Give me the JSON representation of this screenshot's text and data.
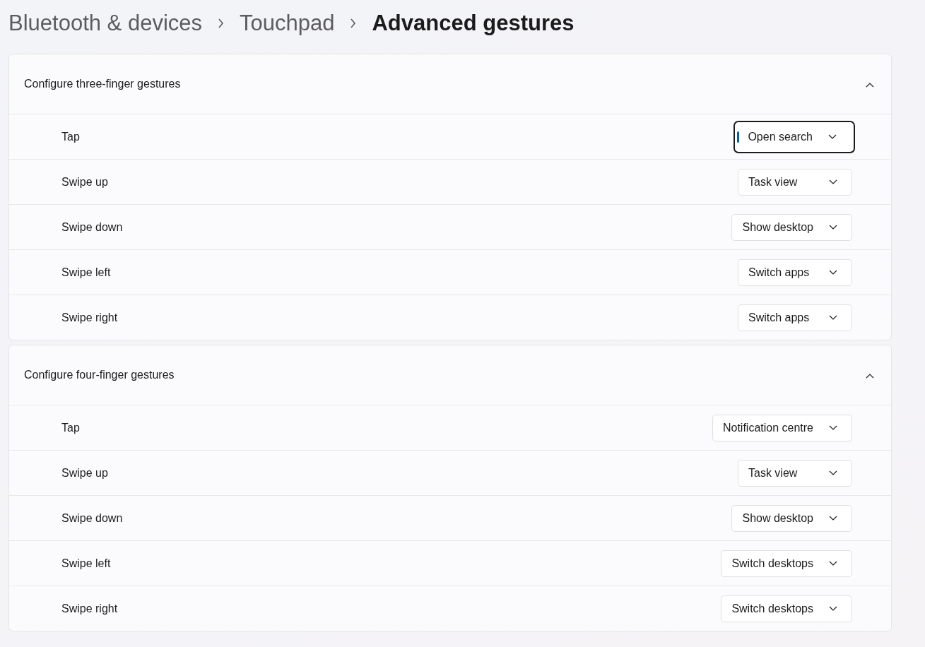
{
  "breadcrumb": [
    {
      "label": "Bluetooth & devices",
      "current": false
    },
    {
      "label": "Touchpad",
      "current": false
    },
    {
      "label": "Advanced gestures",
      "current": true
    }
  ],
  "sections": [
    {
      "title": "Configure three-finger gestures",
      "expanded": true,
      "rows": [
        {
          "label": "Tap",
          "value": "Open search",
          "focused": true
        },
        {
          "label": "Swipe up",
          "value": "Task view",
          "focused": false
        },
        {
          "label": "Swipe down",
          "value": "Show desktop",
          "focused": false
        },
        {
          "label": "Swipe left",
          "value": "Switch apps",
          "focused": false
        },
        {
          "label": "Swipe right",
          "value": "Switch apps",
          "focused": false
        }
      ]
    },
    {
      "title": "Configure four-finger gestures",
      "expanded": true,
      "rows": [
        {
          "label": "Tap",
          "value": "Notification centre",
          "focused": false
        },
        {
          "label": "Swipe up",
          "value": "Task view",
          "focused": false
        },
        {
          "label": "Swipe down",
          "value": "Show desktop",
          "focused": false
        },
        {
          "label": "Swipe left",
          "value": "Switch desktops",
          "focused": false
        },
        {
          "label": "Swipe right",
          "value": "Switch desktops",
          "focused": false
        }
      ]
    }
  ]
}
